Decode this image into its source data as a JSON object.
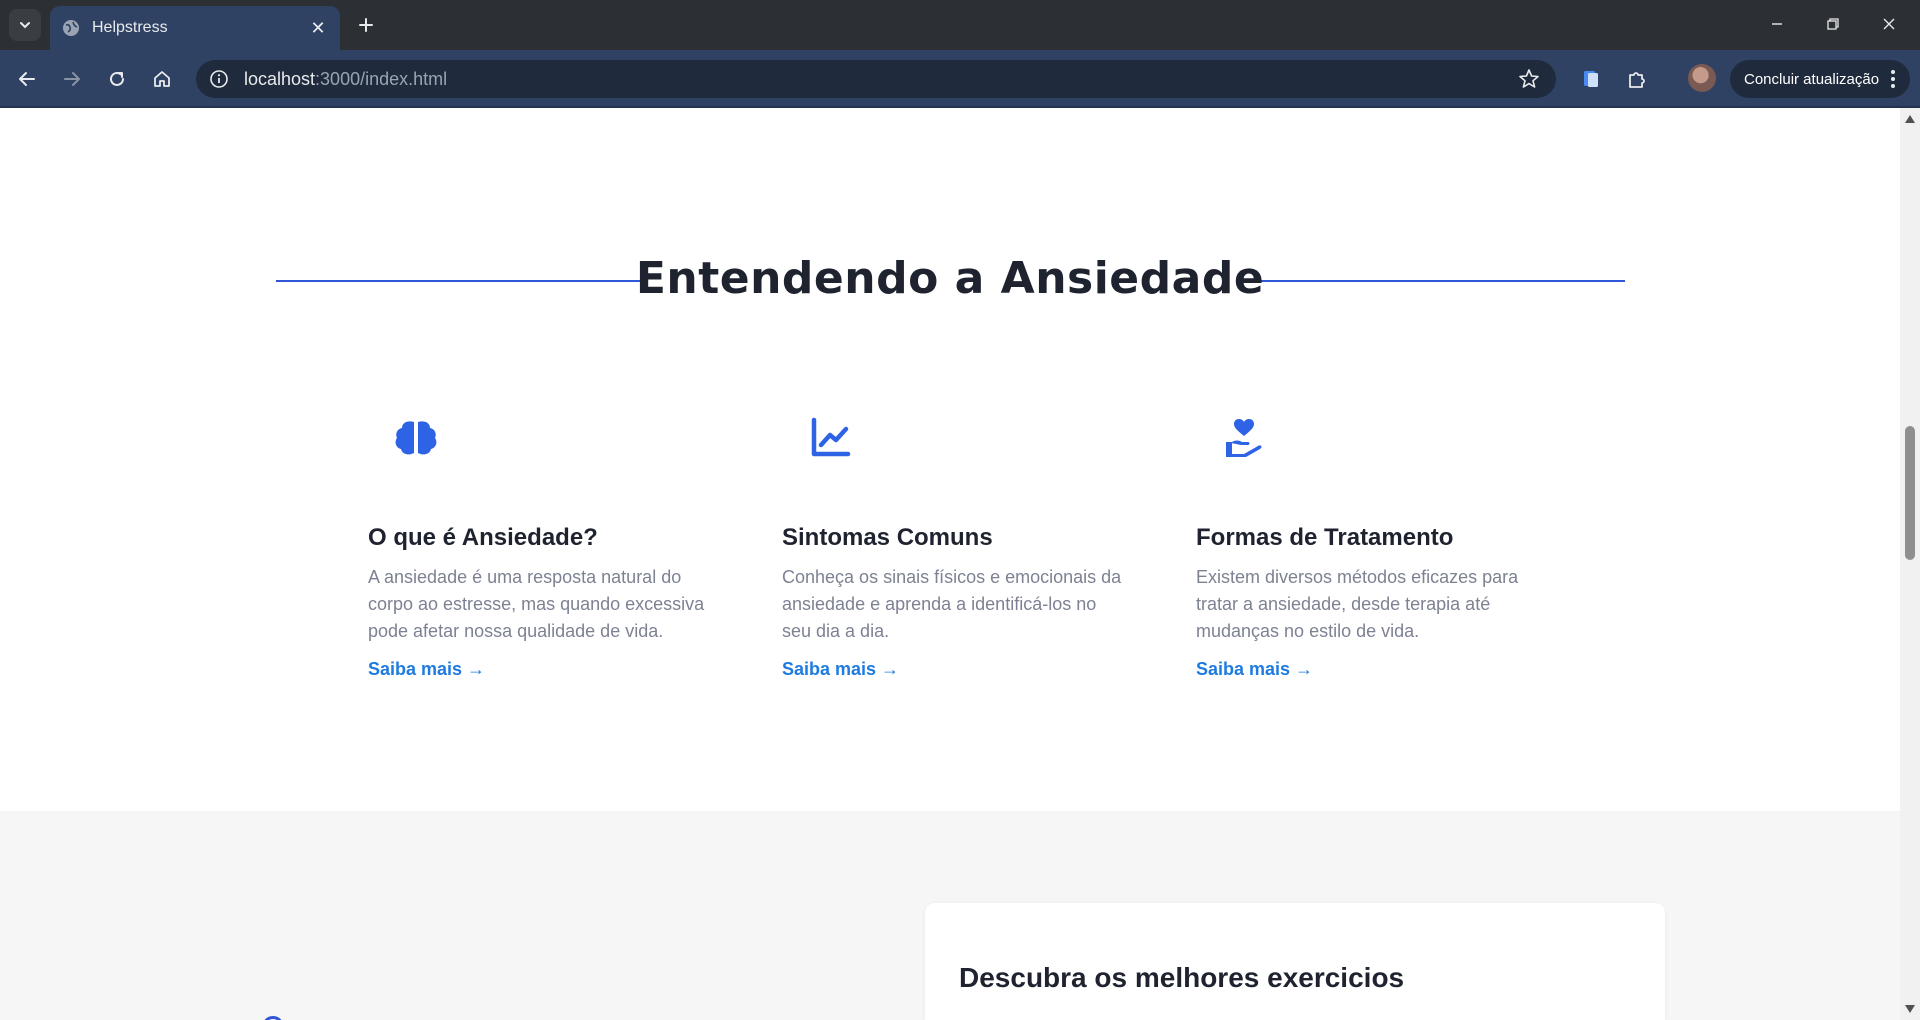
{
  "browser": {
    "tab_title": "Helpstress",
    "url_host": "localhost",
    "url_rest": ":3000/index.html",
    "update_label": "Concluir atualização"
  },
  "page": {
    "section_title": "Entendendo a Ansiedade",
    "cards": [
      {
        "icon": "brain-icon",
        "title": "O que é Ansiedade?",
        "text": "A ansiedade é uma resposta natural do corpo ao estresse, mas quando excessiva pode afetar nossa qualidade de vida.",
        "link": "Saiba mais →"
      },
      {
        "icon": "chart-line-icon",
        "title": "Sintomas Comuns",
        "text": "Conheça os sinais físicos e emocionais da ansiedade e aprenda a identificá-los no seu dia a dia.",
        "link": "Saiba mais →"
      },
      {
        "icon": "hand-holding-heart-icon",
        "title": "Formas de Tratamento",
        "text": "Existem diversos métodos eficazes para tratar a ansiedade, desde terapia até mudanças no estilo de vida.",
        "link": "Saiba mais →"
      }
    ],
    "exercises_title": "Descubra os melhores exercicios"
  },
  "colors": {
    "accent": "#2f56d6",
    "link": "#1e7be0",
    "heading": "#1f2330",
    "body_text": "#7d8293",
    "band_bg": "#f6f6f7"
  }
}
